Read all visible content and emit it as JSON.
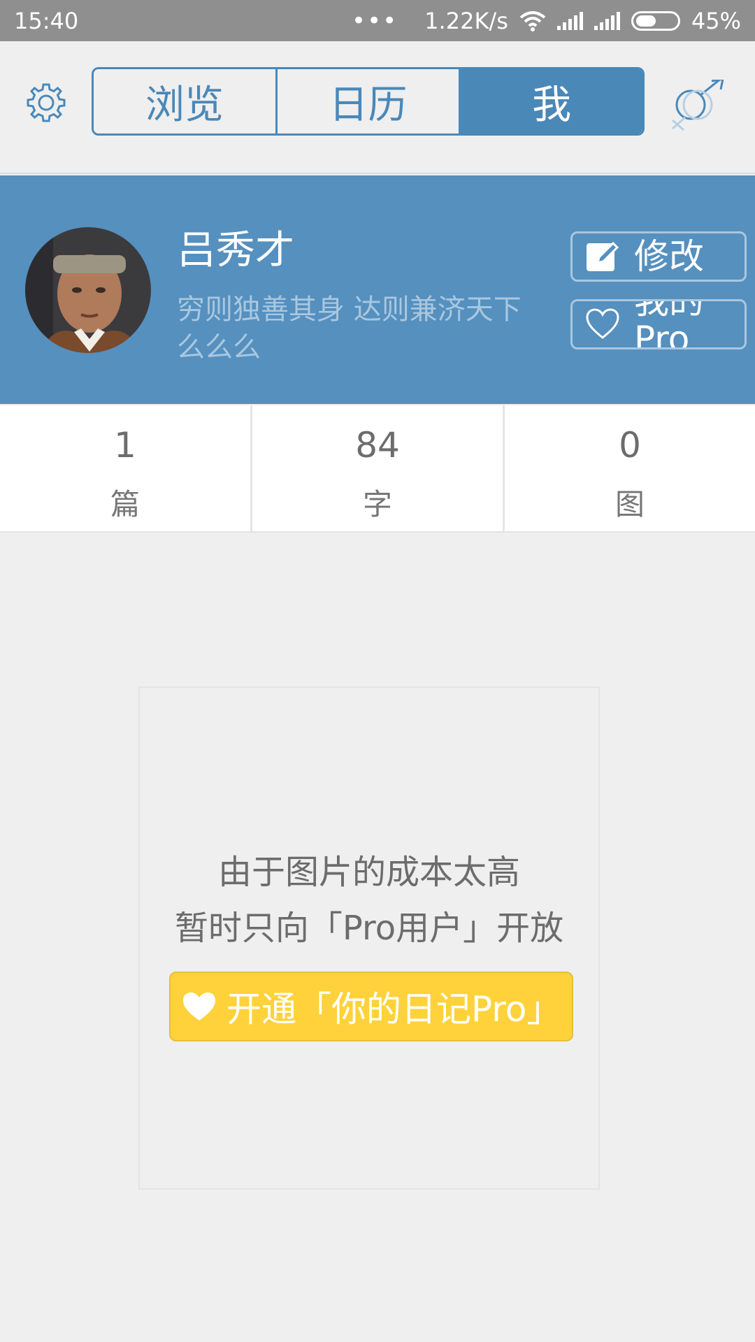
{
  "status_bar": {
    "time": "15:40",
    "dots": "•••",
    "speed": "1.22K/s",
    "battery": "45%",
    "icons": [
      "wifi-icon",
      "signal-icon",
      "signal-icon",
      "battery-icon"
    ]
  },
  "tabs": [
    {
      "label": "浏览",
      "active": false
    },
    {
      "label": "日历",
      "active": false
    },
    {
      "label": "我",
      "active": true
    }
  ],
  "toolbar": {
    "settings_icon": "gear-icon",
    "gender_icon": "gender-male-female-icon"
  },
  "profile": {
    "name": "吕秀才",
    "motto": "穷则独善其身 达则兼济天下 么么么",
    "edit_label": "修改",
    "pro_label": "我的Pro",
    "colors": {
      "banner": "#5590bf",
      "accent": "#4a88b8"
    }
  },
  "stats": [
    {
      "value": "1",
      "unit": "篇"
    },
    {
      "value": "84",
      "unit": "字"
    },
    {
      "value": "0",
      "unit": "图"
    }
  ],
  "notice": {
    "line1": "由于图片的成本太高",
    "line2": "暂时只向「Pro用户」开放",
    "button_label": "开通「你的日记Pro」",
    "button_color": "#ffd23b"
  }
}
